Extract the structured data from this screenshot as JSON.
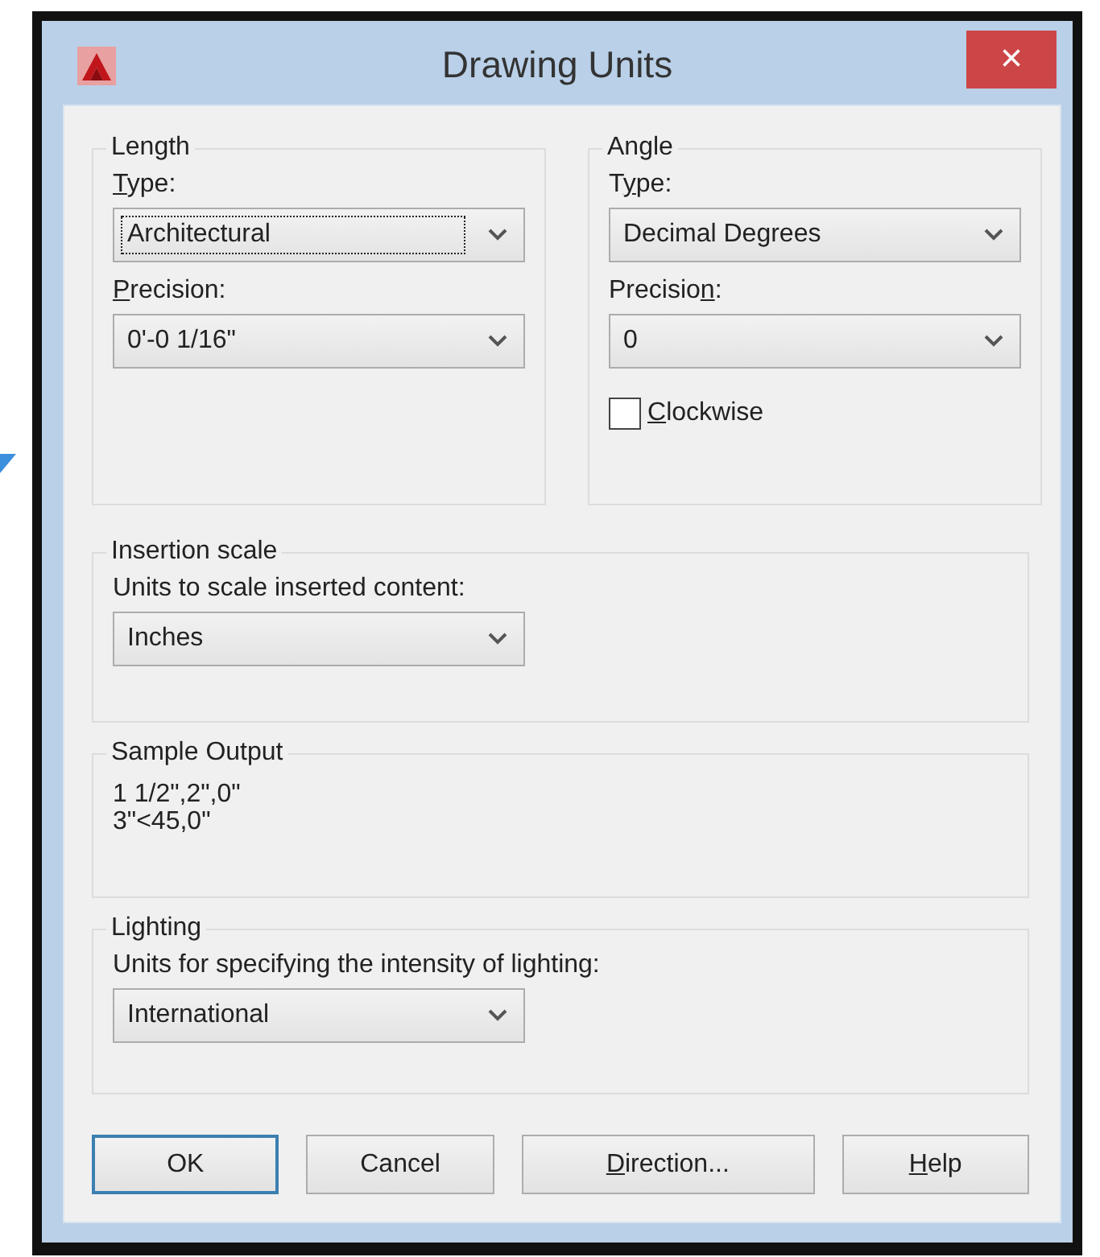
{
  "window": {
    "title": "Drawing Units",
    "close": "×"
  },
  "length": {
    "title": "Length",
    "type_label": [
      {
        "text": "T",
        "underlined": true
      },
      {
        "text": "ype:",
        "underlined": false
      }
    ],
    "type": {
      "value": "Architectural",
      "focused": true
    },
    "precision_label": [
      {
        "text": "P",
        "underlined": true
      },
      {
        "text": "recision:",
        "underlined": false
      }
    ],
    "precision": {
      "value": "0'-0 1/16\"",
      "focused": false
    }
  },
  "angle": {
    "title": "Angle",
    "type_label": [
      {
        "text": "T",
        "underlined": false
      },
      {
        "text": "y",
        "underlined": true
      },
      {
        "text": "pe:",
        "underlined": false
      }
    ],
    "type": {
      "value": "Decimal Degrees",
      "focused": false
    },
    "precision_label": [
      {
        "text": "Precisio",
        "underlined": false
      },
      {
        "text": "n",
        "underlined": true
      },
      {
        "text": ":",
        "underlined": false
      }
    ],
    "precision": {
      "value": "0",
      "focused": false
    },
    "clockwise": {
      "label": [
        {
          "text": "C",
          "underlined": true
        },
        {
          "text": "lockwise",
          "underlined": false
        }
      ],
      "checked": false
    }
  },
  "insertion_scale": {
    "title": "Insertion scale",
    "label": "Units to scale inserted content:",
    "units": {
      "value": "Inches",
      "focused": false
    }
  },
  "sample_output": {
    "title": "Sample Output",
    "lines": [
      "1 1/2\",2\",0\"",
      "3\"<45,0\""
    ]
  },
  "lighting": {
    "title": "Lighting",
    "label": "Units for specifying the intensity of lighting:",
    "units": {
      "value": "International",
      "focused": false
    }
  },
  "buttons": [
    {
      "label": [
        {
          "text": "OK",
          "underlined": false
        }
      ],
      "default": true
    },
    {
      "label": [
        {
          "text": "Cancel",
          "underlined": false
        }
      ],
      "default": false
    },
    {
      "label": [
        {
          "text": "D",
          "underlined": true
        },
        {
          "text": "irection...",
          "underlined": false
        }
      ],
      "default": false
    },
    {
      "label": [
        {
          "text": "H",
          "underlined": true
        },
        {
          "text": "elp",
          "underlined": false
        }
      ],
      "default": false
    }
  ]
}
